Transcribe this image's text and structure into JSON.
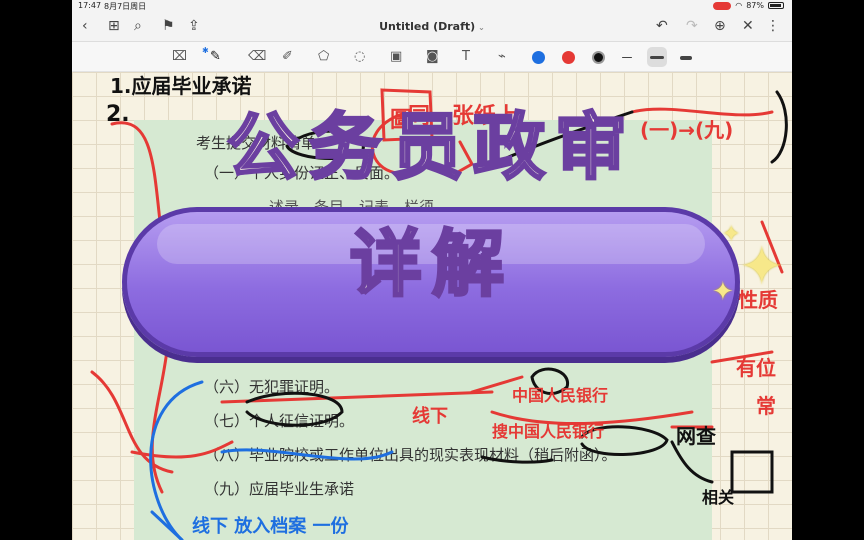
{
  "status": {
    "time": "17:47",
    "date": "8月7日周日",
    "battery": "87%"
  },
  "app": {
    "title": "Untitled (Draft)"
  },
  "document": {
    "heading": "考生提交材料清单",
    "items": [
      "（一）个人身份证正、反面。",
      "（六）无犯罪证明。",
      "（七）个人征信证明。",
      "（八）毕业院校或工作单位出具的现实表现材料（稍后附函）。",
      "（九）应届毕业生承诺"
    ],
    "partial_line": "…述录…条目…记表…栏须"
  },
  "annotations": {
    "top_left": "1.应届毕业承诺",
    "num2": "2.",
    "same_paper": "同一张纸上",
    "range": "(一)→(九)",
    "stamp": "圖",
    "offline": "线下",
    "bank": "中国人民银行",
    "query": "搜中国人民银行",
    "online": "网查",
    "related": "相关",
    "right1": "有位",
    "right2": "常",
    "right3": "性质",
    "bottom": "线下 放入档案 一份"
  },
  "banner": {
    "line1": "公务员政审",
    "line2": "详解"
  },
  "colors": {
    "red": "#e53935",
    "black": "#111111",
    "blue": "#1e6fe0",
    "banner": "#8d6ce0"
  }
}
